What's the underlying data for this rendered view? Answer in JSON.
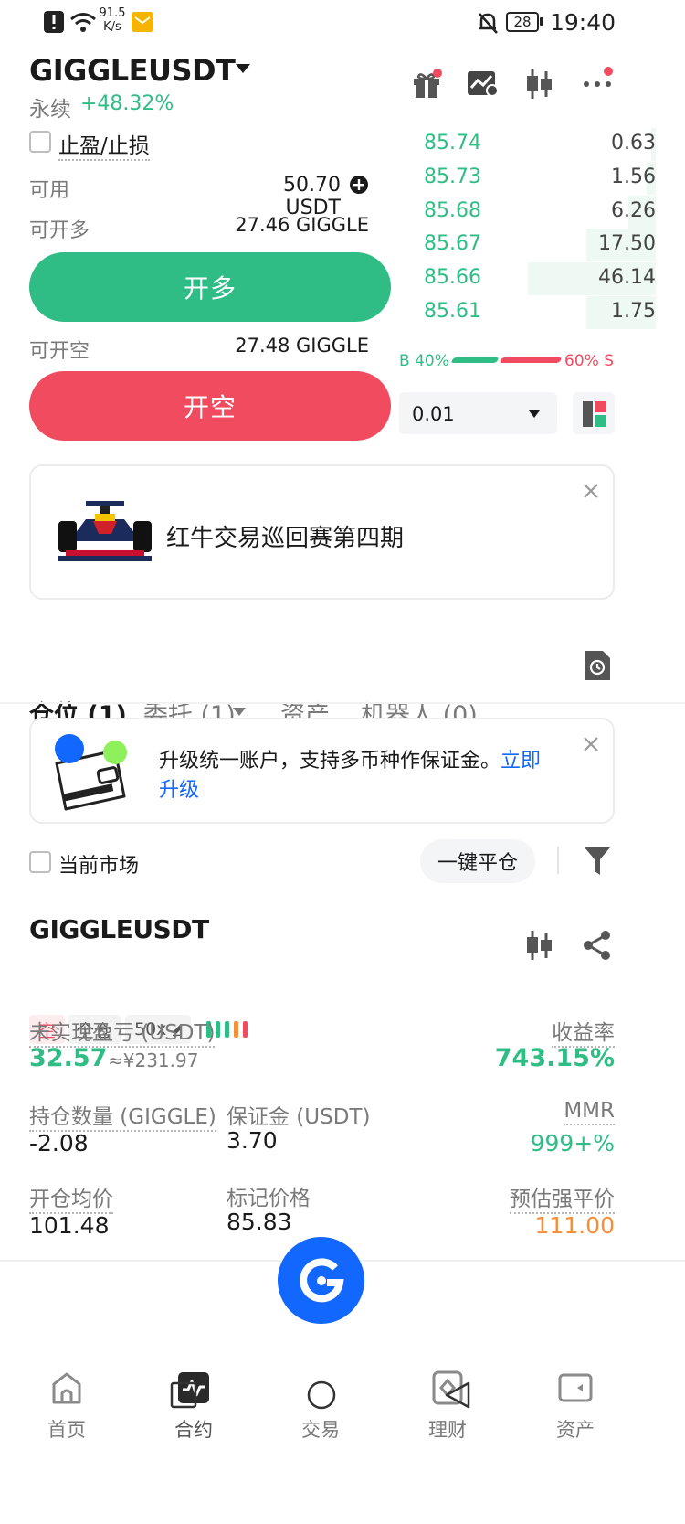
{
  "status": {
    "speed_value": "91.5",
    "speed_unit": "K/s",
    "battery": "28",
    "time": "19:40"
  },
  "header": {
    "symbol": "GIGGLEUSDT",
    "contract_type": "永续",
    "change": "+48.32%"
  },
  "order_form": {
    "tpsl_label": "止盈/止损",
    "available_label": "可用",
    "available_value": "50.70 USDT",
    "open_long_avail_label": "可开多",
    "open_long_avail_value": "27.46 GIGGLE",
    "open_long_button": "开多",
    "open_short_avail_label": "可开空",
    "open_short_avail_value": "27.48 GIGGLE",
    "open_short_button": "开空"
  },
  "orderbook": {
    "bids": [
      {
        "price": "85.74",
        "qty": "0.63",
        "depth": 0.02
      },
      {
        "price": "85.73",
        "qty": "1.56",
        "depth": 0.04
      },
      {
        "price": "85.68",
        "qty": "6.26",
        "depth": 0.12
      },
      {
        "price": "85.67",
        "qty": "17.50",
        "depth": 0.3
      },
      {
        "price": "85.66",
        "qty": "46.14",
        "depth": 0.55
      },
      {
        "price": "85.61",
        "qty": "1.75",
        "depth": 0.3
      }
    ],
    "buy_label": "B 40%",
    "sell_label": "60% S",
    "buy_ratio": 0.4,
    "precision": "0.01"
  },
  "promo": {
    "title": "红牛交易巡回赛第四期"
  },
  "tabs": [
    {
      "label": "仓位 (1)"
    },
    {
      "label": "委托 (1)"
    },
    {
      "label": "资产"
    },
    {
      "label": "机器人 (0)"
    }
  ],
  "upgrade_banner": {
    "text": "升级统一账户，支持多币种作保证金。",
    "link_part1": "立即",
    "link_part2": "升级"
  },
  "filter_bar": {
    "current_market": "当前市场",
    "close_all": "一键平仓"
  },
  "position": {
    "symbol": "GIGGLEUSDT",
    "side_tag": "空",
    "margin_mode": "全仓",
    "leverage": "50x",
    "unrealized_label": "未实现盈亏 (USDT)",
    "unrealized_value": "32.57",
    "unrealized_cny": "≈¥231.97",
    "roe_label": "收益率",
    "roe_value": "743.15%",
    "size_label": "持仓数量 (GIGGLE)",
    "size_value": "-2.08",
    "margin_label": "保证金 (USDT)",
    "margin_value": "3.70",
    "mmr_label": "MMR",
    "mmr_value": "999+%",
    "entry_label": "开仓均价",
    "entry_value": "101.48",
    "mark_label": "标记价格",
    "mark_value": "85.83",
    "liq_label": "预估强平价",
    "liq_value": "111.00"
  },
  "bottom_nav": [
    {
      "label": "首页",
      "icon": "home-icon"
    },
    {
      "label": "合约",
      "icon": "futures-icon"
    },
    {
      "label": "交易",
      "icon": "trade-logo-icon"
    },
    {
      "label": "理财",
      "icon": "earn-icon"
    },
    {
      "label": "资产",
      "icon": "wallet-icon"
    }
  ],
  "colors": {
    "green": "#2fbd85",
    "red": "#f04b5f",
    "blue": "#1267fe",
    "orange": "#f58f3b"
  }
}
